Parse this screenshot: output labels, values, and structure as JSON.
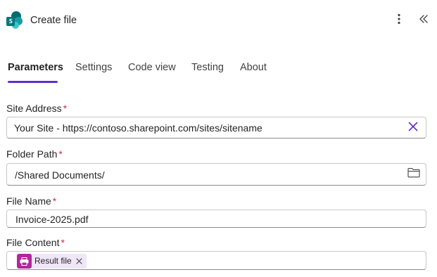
{
  "header": {
    "title": "Create file",
    "app_icon": "sharepoint-icon",
    "more_icon": "more-vertical-icon",
    "collapse_icon": "double-chevron-left-icon"
  },
  "tabs": [
    {
      "label": "Parameters",
      "active": true
    },
    {
      "label": "Settings",
      "active": false
    },
    {
      "label": "Code view",
      "active": false
    },
    {
      "label": "Testing",
      "active": false
    },
    {
      "label": "About",
      "active": false
    }
  ],
  "form": {
    "required_marker": "*",
    "site_address": {
      "label": "Site Address",
      "value": "Your Site - https://contoso.sharepoint.com/sites/sitename",
      "clear_icon": "close-icon"
    },
    "folder_path": {
      "label": "Folder Path",
      "value": "/Shared Documents/",
      "browse_icon": "folder-icon"
    },
    "file_name": {
      "label": "File Name",
      "value": "Invoice-2025.pdf"
    },
    "file_content": {
      "label": "File Content",
      "token": {
        "label": "Result file",
        "icon": "printer-icon",
        "remove_icon": "close-icon"
      }
    }
  },
  "colors": {
    "accent": "#5b2fd1",
    "required": "#c4314b",
    "token_background": "#efe6f7",
    "token_icon": "#b1279c"
  }
}
